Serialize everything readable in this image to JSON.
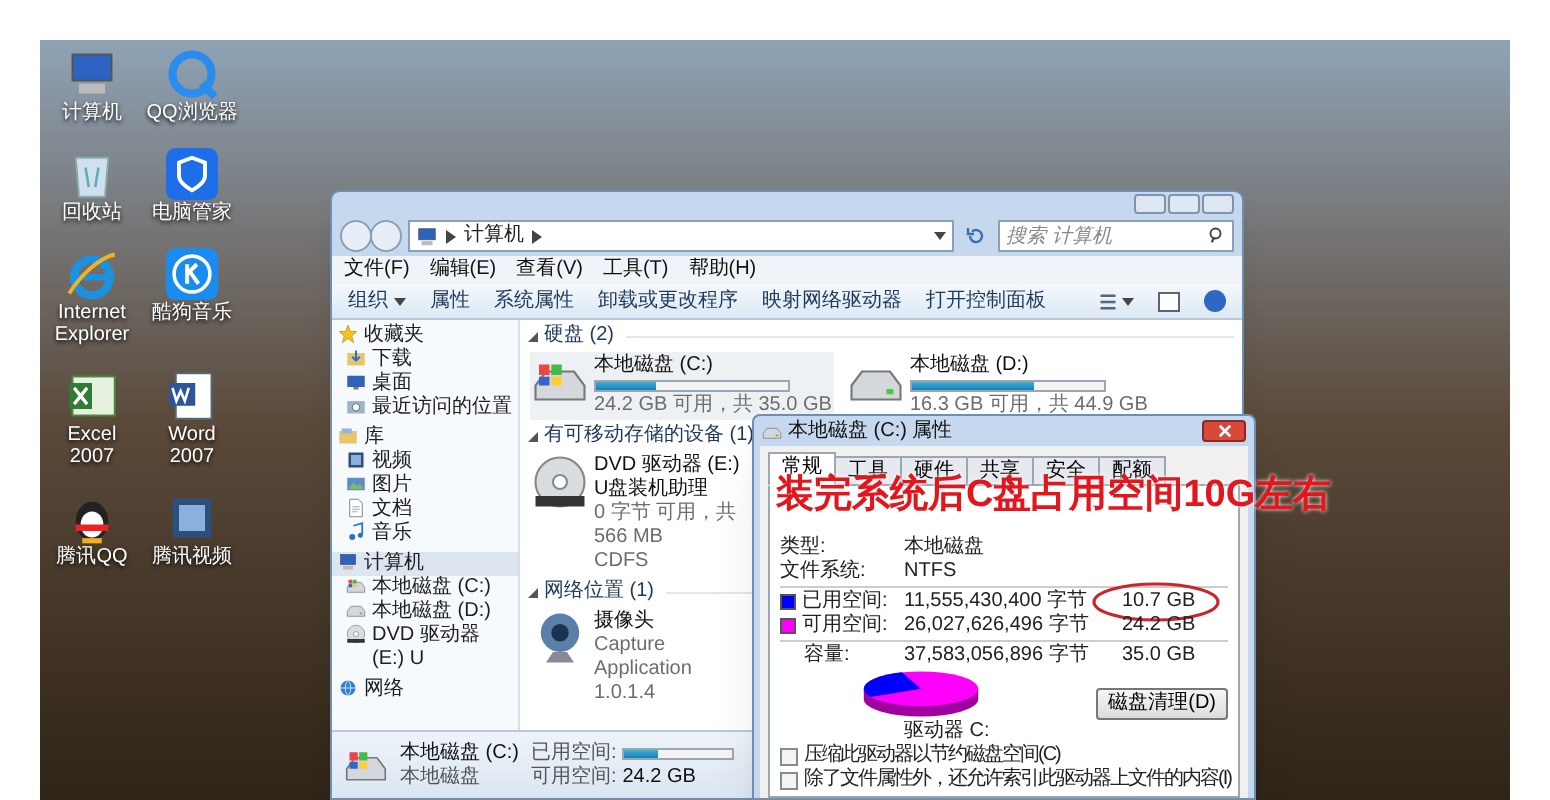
{
  "desktop": {
    "icons": [
      {
        "kind": "computer",
        "label": "计算机"
      },
      {
        "kind": "qqbrowser",
        "label": "QQ浏览器"
      },
      {
        "kind": "recycle",
        "label": "回收站"
      },
      {
        "kind": "guard",
        "label": "电脑管家"
      },
      {
        "kind": "ie",
        "label": "Internet Explorer"
      },
      {
        "kind": "kugou",
        "label": "酷狗音乐"
      },
      {
        "kind": "excel",
        "label": "Excel 2007"
      },
      {
        "kind": "word",
        "label": "Word 2007"
      },
      {
        "kind": "qq",
        "label": "腾讯QQ"
      },
      {
        "kind": "video",
        "label": "腾讯视频"
      }
    ]
  },
  "explorer": {
    "address": [
      "计算机"
    ],
    "search": {
      "placeholder": "搜索 计算机"
    },
    "menu": [
      "文件(F)",
      "编辑(E)",
      "查看(V)",
      "工具(T)",
      "帮助(H)"
    ],
    "toolbar": [
      {
        "label": "组织",
        "dropdown": true
      },
      {
        "label": "属性",
        "dropdown": false
      },
      {
        "label": "系统属性",
        "dropdown": false
      },
      {
        "label": "卸载或更改程序",
        "dropdown": false
      },
      {
        "label": "映射网络驱动器",
        "dropdown": false
      },
      {
        "label": "打开控制面板",
        "dropdown": false
      }
    ],
    "sidebar": [
      {
        "label": "收藏夹",
        "kind": "star",
        "selected": false,
        "children": [
          {
            "label": "下载",
            "kind": "download",
            "selected": false
          },
          {
            "label": "桌面",
            "kind": "desktop",
            "selected": false
          },
          {
            "label": "最近访问的位置",
            "kind": "recent",
            "selected": false
          }
        ]
      },
      {
        "label": "库",
        "kind": "library",
        "selected": false,
        "children": [
          {
            "label": "视频",
            "kind": "video",
            "selected": false
          },
          {
            "label": "图片",
            "kind": "picture",
            "selected": false
          },
          {
            "label": "文档",
            "kind": "document",
            "selected": false
          },
          {
            "label": "音乐",
            "kind": "music",
            "selected": false
          }
        ]
      },
      {
        "label": "计算机",
        "kind": "computer",
        "selected": true,
        "children": [
          {
            "label": "本地磁盘 (C:)",
            "kind": "hdd-win",
            "selected": false
          },
          {
            "label": "本地磁盘 (D:)",
            "kind": "hdd",
            "selected": false
          },
          {
            "label": "DVD 驱动器 (E:) U",
            "kind": "dvd",
            "selected": false
          }
        ]
      },
      {
        "label": "网络",
        "kind": "network",
        "selected": false
      }
    ],
    "sections": [
      {
        "title": "硬盘 (2)",
        "items": [
          {
            "kind": "hdd-win",
            "name": "本地磁盘 (C:)",
            "level": 0.31,
            "info": "24.2 GB 可用，共 35.0 GB"
          },
          {
            "kind": "hdd",
            "name": "本地磁盘 (D:)",
            "level": 0.64,
            "info": "16.3 GB 可用，共 44.9 GB"
          }
        ]
      },
      {
        "title": "有可移动存储的设备 (1)",
        "items": [
          {
            "kind": "dvd",
            "name": "DVD 驱动器 (E:) U盘装机助理",
            "info": "0 字节 可用，共 566 MB",
            "extra": "CDFS"
          }
        ]
      },
      {
        "title": "网络位置 (1)",
        "items": [
          {
            "kind": "webcam",
            "name": "摄像头",
            "info": "Capture Application",
            "extra": "1.0.1.4"
          }
        ]
      }
    ],
    "details": {
      "kind": "hdd-win",
      "name": "本地磁盘 (C:)",
      "type": "本地磁盘",
      "used_label": "已用空间:",
      "level": 0.31,
      "free_label": "可用空间:",
      "free": "24.2 GB"
    }
  },
  "dialog": {
    "title": "本地磁盘 (C:) 属性",
    "tabs": [
      {
        "label": "常规",
        "selected": true
      },
      {
        "label": "工具",
        "selected": false
      },
      {
        "label": "硬件",
        "selected": false
      },
      {
        "label": "共享",
        "selected": false
      },
      {
        "label": "安全",
        "selected": false
      },
      {
        "label": "配额",
        "selected": false
      }
    ],
    "type_label": "类型:",
    "type": "本地磁盘",
    "fs_label": "文件系统:",
    "fs": "NTFS",
    "usage": [
      {
        "color": "#0000ff",
        "label": "已用空间:",
        "bytes": "11,555,430,400 字节",
        "size": "10.7 GB",
        "highlighted": true
      },
      {
        "color": "#ff00ff",
        "label": "可用空间:",
        "bytes": "26,027,626,496 字节",
        "size": "24.2 GB",
        "highlighted": false
      }
    ],
    "capacity": {
      "label": "容量:",
      "bytes": "37,583,056,896 字节",
      "size": "35.0 GB"
    },
    "drive_label": "驱动器 C:",
    "cleanup_button": "磁盘清理(D)",
    "options": [
      {
        "label": "压缩此驱动器以节约磁盘空间(C)",
        "checked": false
      },
      {
        "label": "除了文件属性外，还允许索引此驱动器上文件的内容(I)",
        "checked": false
      }
    ]
  },
  "annotation": "装完系统后C盘占用空间10G左右"
}
